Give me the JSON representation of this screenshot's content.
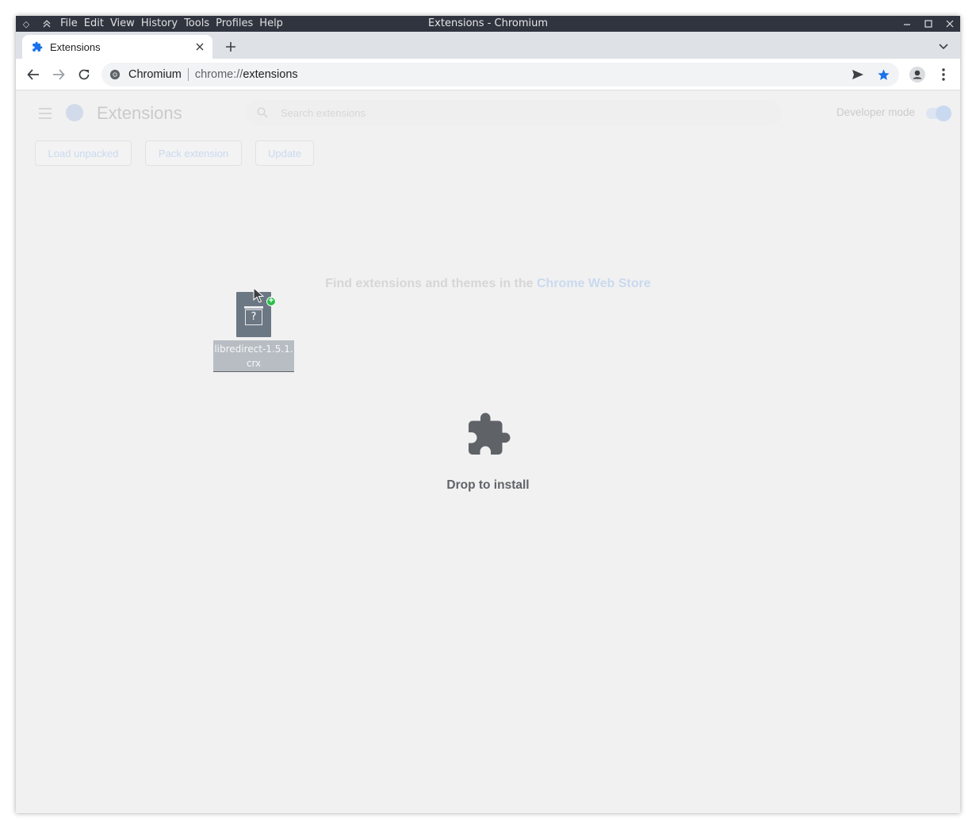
{
  "window": {
    "title": "Extensions - Chromium",
    "menu": [
      "File",
      "Edit",
      "View",
      "History",
      "Tools",
      "Profiles",
      "Help"
    ]
  },
  "tabs": [
    {
      "label": "Extensions",
      "icon": "puzzle-icon",
      "active": true
    }
  ],
  "omnibox": {
    "site_name": "Chromium",
    "url_scheme": "chrome://",
    "url_path": "extensions"
  },
  "extensions_page": {
    "title": "Extensions",
    "search_placeholder": "Search extensions",
    "developer_mode_label": "Developer mode",
    "developer_mode_on": true,
    "buttons": {
      "load_unpacked": "Load unpacked",
      "pack_extension": "Pack extension",
      "update": "Update"
    },
    "store_text": "Find extensions and themes in the",
    "store_link": "Chrome Web Store",
    "drop_label": "Drop to install"
  },
  "drag": {
    "file_name_line1": "libredirect-1.5.1.",
    "file_name_line2": "crx",
    "file_icon_glyph": "?",
    "badge_glyph": "+"
  },
  "colors": {
    "accent": "#1a73e8",
    "titlebar": "#2f343f",
    "tabstrip": "#dee1e6",
    "content_bg": "#f1f1f1",
    "drop_icon": "#5f6368",
    "badge": "#2bc04b"
  }
}
